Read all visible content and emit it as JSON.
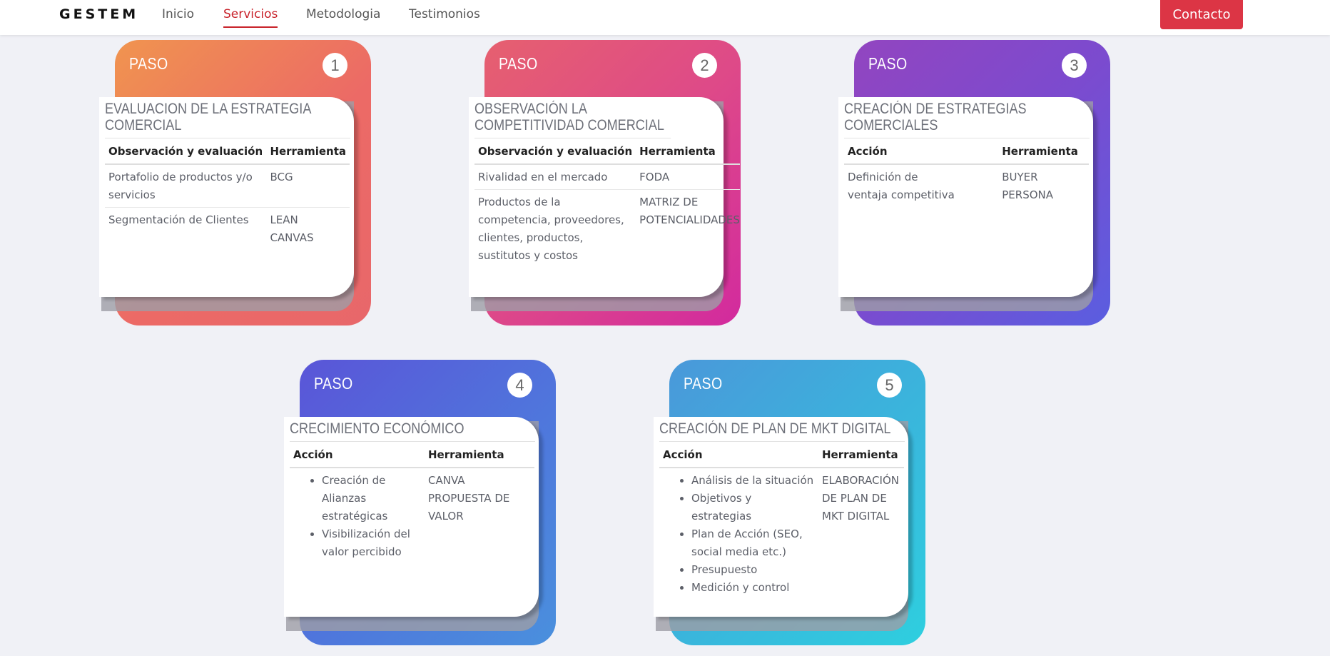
{
  "brand": "GESTEM",
  "nav": {
    "links": [
      "Inicio",
      "Servicios",
      "Metodologia",
      "Testimonios"
    ],
    "contact": "Contacto"
  },
  "colors": {
    "accent": "#dc3545",
    "active_link": "#c8222a"
  },
  "steps": [
    {
      "label": "PASO",
      "number": "1",
      "title": "EVALUACION DE LA ESTRATEGIA COMERCIAL",
      "col1": "Observación y evaluación",
      "col2": "Herramienta",
      "rows": [
        {
          "a": "Portafolio de productos y/o servicios",
          "b": "BCG"
        },
        {
          "a": "Segmentación de Clientes",
          "b": "LEAN CANVAS"
        }
      ]
    },
    {
      "label": "PASO",
      "number": "2",
      "title": "OBSERVACIÓN LA COMPETITIVIDAD COMERCIAL",
      "col1": "Observación y evaluación",
      "col2": "Herramienta",
      "rows": [
        {
          "a": "Rivalidad en el mercado",
          "b": "FODA"
        },
        {
          "a": "Productos de la competencia, proveedores, clientes, productos, sustitutos y costos",
          "b": "MATRIZ DE POTENCIALIDADES"
        }
      ]
    },
    {
      "label": "PASO",
      "number": "3",
      "title": "CREACIÓN DE ESTRATEGIAS COMERCIALES",
      "col1": "Acción",
      "col2": "Herramienta",
      "rows": [
        {
          "a": "Definición de ventaja competitiva",
          "b": "BUYER PERSONA"
        }
      ]
    },
    {
      "label": "PASO",
      "number": "4",
      "title": "CRECIMIENTO ECONÓMICO",
      "col1": "Acción",
      "col2": "Herramienta",
      "items": [
        "Creación de Alianzas estratégicas",
        "Visibilización  del valor percibido"
      ],
      "tool": "CANVA PROPUESTA DE VALOR"
    },
    {
      "label": "PASO",
      "number": "5",
      "title": "CREACIÓN DE PLAN DE MKT DIGITAL",
      "col1": "Acción",
      "col2": "Herramienta",
      "items": [
        "Análisis de la situación",
        "Objetivos y estrategias",
        "Plan de Acción (SEO, social media etc.)",
        "Presupuesto",
        "Medición y control"
      ],
      "tool": "ELABORACIÓN DE PLAN DE MKT DIGITAL"
    }
  ]
}
